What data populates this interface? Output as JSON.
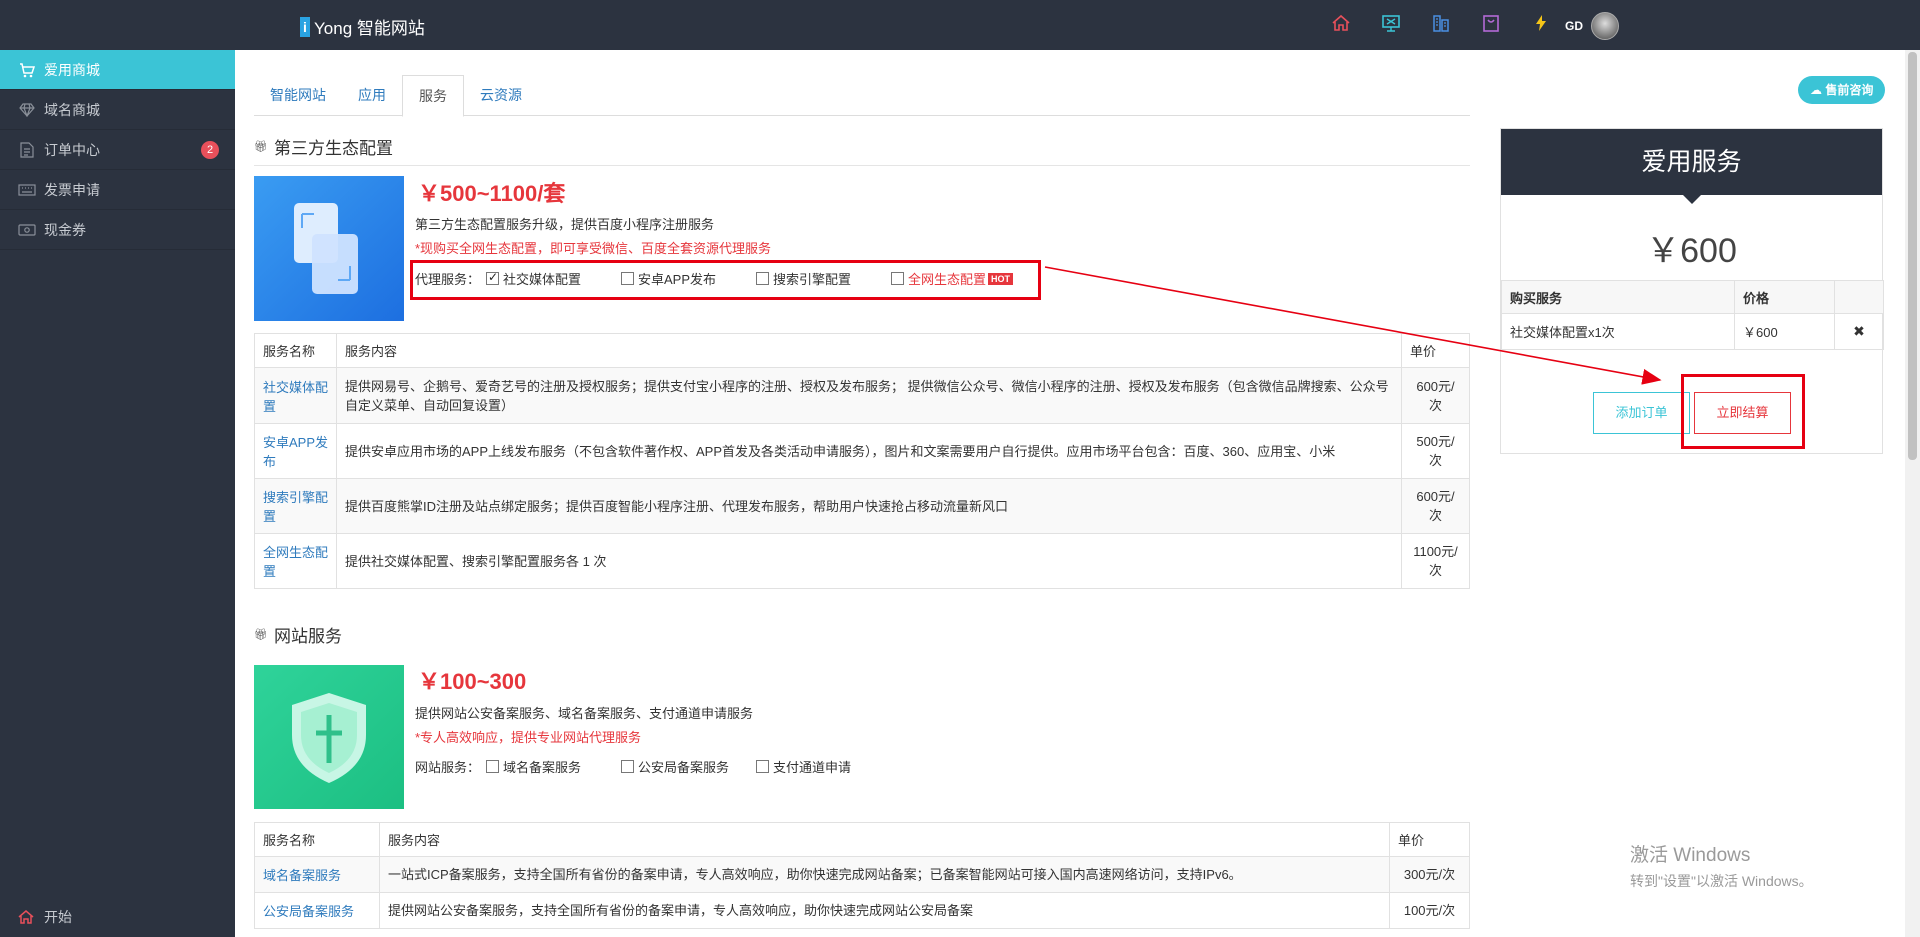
{
  "header": {
    "brand_letter": "i",
    "brand_text": "Yong 智能网站",
    "user": "GD",
    "icons": [
      "home-icon",
      "monitor-icon",
      "building-icon",
      "bag-icon",
      "lightning-icon"
    ]
  },
  "sidebar": {
    "items": [
      {
        "label": "爱用商城",
        "icon": "cart-icon"
      },
      {
        "label": "域名商城",
        "icon": "diamond-icon"
      },
      {
        "label": "订单中心",
        "icon": "document-icon",
        "badge": "2"
      },
      {
        "label": "发票申请",
        "icon": "keyboard-icon"
      },
      {
        "label": "现金券",
        "icon": "ticket-icon"
      }
    ],
    "bottom_label": "开始"
  },
  "tabs": [
    "智能网站",
    "应用",
    "服务",
    "云资源"
  ],
  "active_tab": "服务",
  "consult_label": "售前咨询",
  "section1": {
    "title": "第三方生态配置",
    "price": "￥500~1100/套",
    "desc": "第三方生态配置服务升级，提供百度小程序注册服务",
    "note": "*现购买全网生态配置，即可享受微信、百度全套资源代理服务",
    "options_label": "代理服务：",
    "options": [
      {
        "label": "社交媒体配置",
        "checked": true
      },
      {
        "label": "安卓APP发布",
        "checked": false
      },
      {
        "label": "搜索引擎配置",
        "checked": false
      },
      {
        "label": "全网生态配置",
        "checked": false,
        "hot": "HOT"
      }
    ],
    "table": {
      "headers": [
        "服务名称",
        "服务内容",
        "单价"
      ],
      "rows": [
        {
          "name": "社交媒体配置",
          "content": "提供网易号、企鹅号、爱奇艺号的注册及授权服务；提供支付宝小程序的注册、授权及发布服务； 提供微信公众号、微信小程序的注册、授权及发布服务（包含微信品牌搜索、公众号自定义菜单、自动回复设置）",
          "price": "600元/次"
        },
        {
          "name": "安卓APP发布",
          "content": "提供安卓应用市场的APP上线发布服务（不包含软件著作权、APP首发及各类活动申请服务），图片和文案需要用户自行提供。应用市场平台包含：百度、360、应用宝、小米",
          "price": "500元/次"
        },
        {
          "name": "搜索引擎配置",
          "content": "提供百度熊掌ID注册及站点绑定服务；提供百度智能小程序注册、代理发布服务，帮助用户快速抢占移动流量新风口",
          "price": "600元/次"
        },
        {
          "name": "全网生态配置",
          "content": "提供社交媒体配置、搜索引擎配置服务各 1 次",
          "price": "1100元/次"
        }
      ]
    }
  },
  "section2": {
    "title": "网站服务",
    "price": "￥100~300",
    "desc": "提供网站公安备案服务、域名备案服务、支付通道申请服务",
    "note": "*专人高效响应，提供专业网站代理服务",
    "options_label": "网站服务：",
    "options": [
      {
        "label": "域名备案服务",
        "checked": false
      },
      {
        "label": "公安局备案服务",
        "checked": false
      },
      {
        "label": "支付通道申请",
        "checked": false
      }
    ],
    "table": {
      "headers": [
        "服务名称",
        "服务内容",
        "单价"
      ],
      "rows": [
        {
          "name": "域名备案服务",
          "content": "一站式ICP备案服务，支持全国所有省份的备案申请，专人高效响应，助你快速完成网站备案；已备案智能网站可接入国内高速网络访问，支持IPv6。",
          "price": "300元/次"
        },
        {
          "name": "公安局备案服务",
          "content": "提供网站公安备案服务，支持全国所有省份的备案申请，专人高效响应，助你快速完成网站公安局备案",
          "price": "100元/次"
        }
      ]
    }
  },
  "cart": {
    "title": "爱用服务",
    "total": "￥600",
    "headers": [
      "购买服务",
      "价格",
      ""
    ],
    "items": [
      {
        "name": "社交媒体配置x1次",
        "price": "￥600",
        "remove": "✖"
      }
    ],
    "add_label": "添加订单",
    "pay_label": "立即结算"
  },
  "watermark": {
    "line1": "激活 Windows",
    "line2": "转到\"设置\"以激活 Windows。"
  },
  "colors": {
    "sidebar_bg": "#2c3340",
    "accent": "#3bc4d6",
    "price_red": "#e6363c",
    "link_blue": "#2f7bbd"
  }
}
